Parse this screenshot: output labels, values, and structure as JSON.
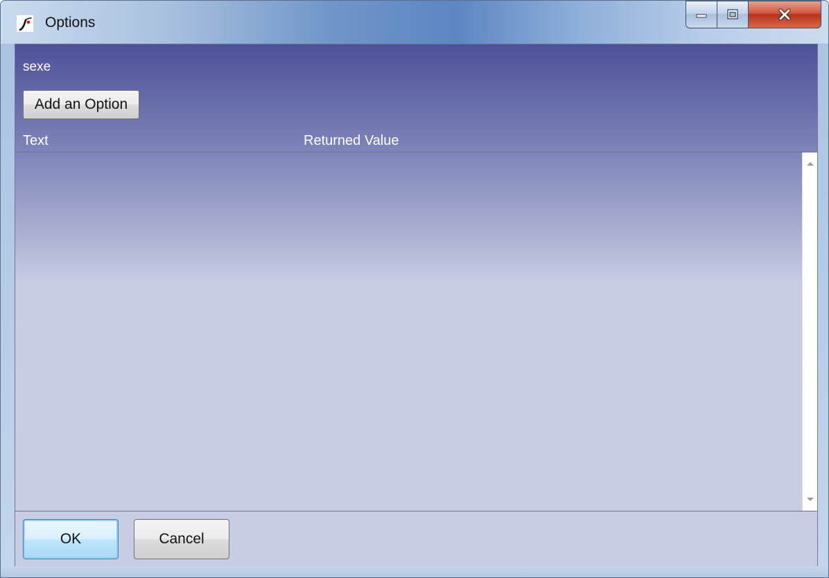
{
  "window": {
    "title": "Options",
    "icon": "app-logo-icon",
    "controls": {
      "minimize_icon": "minimize-icon",
      "maximize_icon": "maximize-icon",
      "close_icon": "close-icon"
    }
  },
  "content": {
    "field_name": "sexe",
    "add_button_label": "Add an Option",
    "columns": [
      "Text",
      "Returned Value"
    ],
    "rows": []
  },
  "footer": {
    "ok_label": "OK",
    "cancel_label": "Cancel"
  },
  "colors": {
    "header_gradient_top": "#4e5199",
    "list_background": "#c8cde4",
    "close_button": "#c9452c"
  }
}
